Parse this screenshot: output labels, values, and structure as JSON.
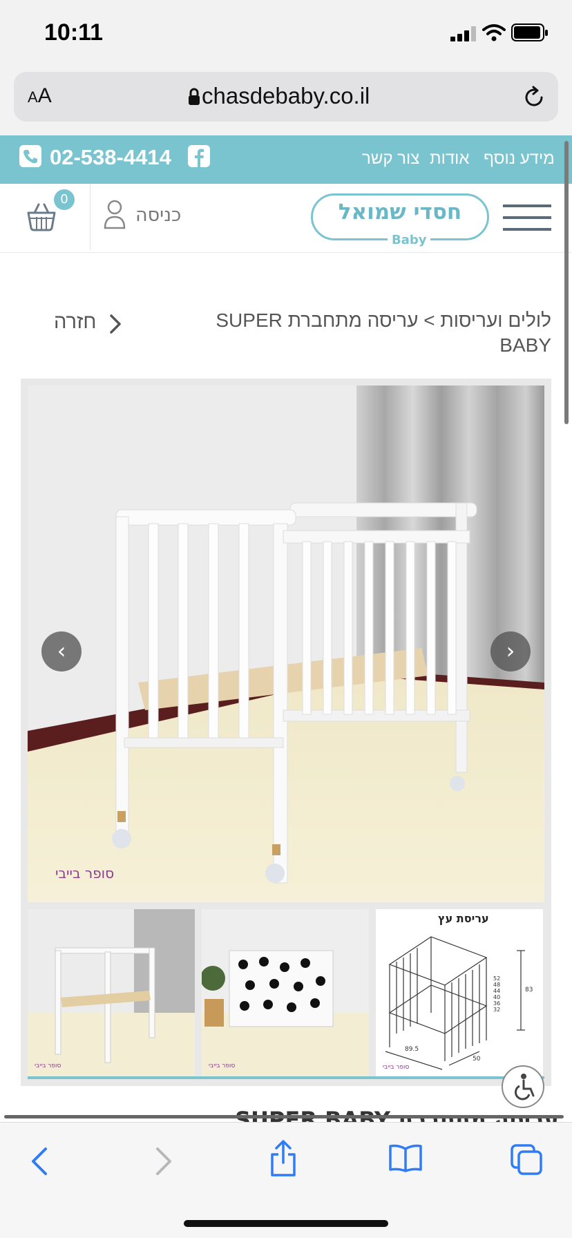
{
  "status_bar": {
    "time": "10:11"
  },
  "browser": {
    "text_size_label_small": "A",
    "text_size_label_large": "A",
    "url": "chasdebaby.co.il"
  },
  "top_strip": {
    "phone": "02-538-4414",
    "links": [
      "מידע נוסף",
      "אודות",
      "צור קשר"
    ]
  },
  "header": {
    "cart_count": "0",
    "login_label": "כניסה",
    "logo_hebrew": "חסדי שמואל",
    "logo_english": "Baby"
  },
  "breadcrumb": {
    "path": "לולים ועריסות > עריסה מתחברת SUPER BABY",
    "back_label": "חזרה"
  },
  "gallery": {
    "watermark": "סופר בייבי",
    "thumbnails": [
      {
        "watermark": "סופר בייבי"
      },
      {
        "watermark": "סופר בייבי"
      },
      {
        "title": "עריסת עץ",
        "dims": [
          "52",
          "48",
          "44",
          "40",
          "36",
          "32"
        ],
        "height": "83",
        "width": "89.5",
        "depth": "50",
        "watermark": "סופר בייבי"
      }
    ]
  },
  "product_title_partial": "עריסה מתחברת SUPER BABY",
  "colors": {
    "accent": "#7ac4d0",
    "ios_blue": "#2f7cf6"
  }
}
